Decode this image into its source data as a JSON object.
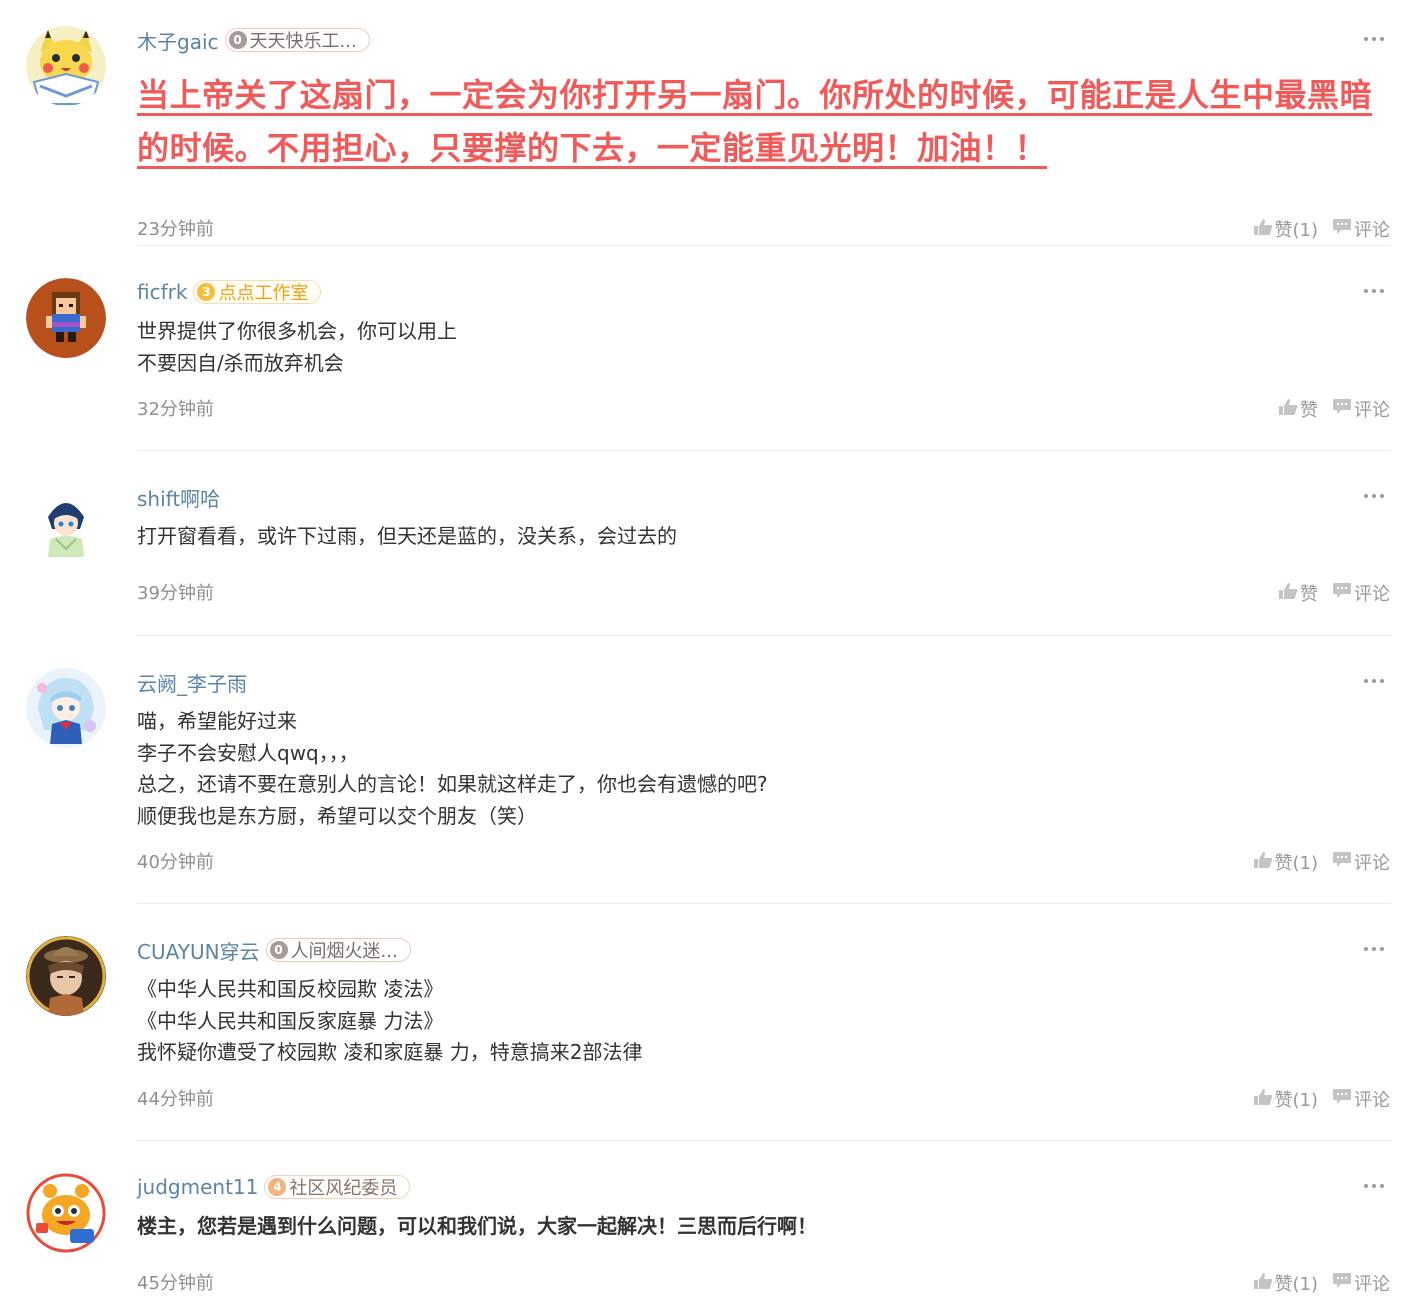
{
  "comments": [
    {
      "username": "木子gaic",
      "badge": {
        "level": "0",
        "text": "天天快乐工...",
        "style": "grey"
      },
      "lines": [
        "当上帝关了这扇门，一定会为你打开另一扇门。你所处的时候，可能正是人生中最黑暗的时候。不用担心，只要撑的下去，一定能重见光明！加油！！"
      ],
      "text_style": "red-bold-underline",
      "time": "23分钟前",
      "like_label": "赞(1)",
      "reply_label": "评论",
      "avatar_icon": "pikachu-avatar-icon"
    },
    {
      "username": "ficfrk",
      "badge": {
        "level": "3",
        "text": "点点工作室",
        "style": "gold"
      },
      "lines": [
        "世界提供了你很多机会，你可以用上",
        "不要因自/杀而放弃机会"
      ],
      "text_style": "normal",
      "time": "32分钟前",
      "like_label": "赞",
      "reply_label": "评论",
      "avatar_icon": "pixel-character-avatar-icon"
    },
    {
      "username": "shift啊哈",
      "badge": null,
      "lines": [
        "打开窗看看，或许下过雨，但天还是蓝的，没关系，会过去的"
      ],
      "text_style": "normal",
      "time": "39分钟前",
      "like_label": "赞",
      "reply_label": "评论",
      "avatar_icon": "anime-boy-avatar-icon"
    },
    {
      "username": "云阙_李子雨",
      "badge": null,
      "lines": [
        "喵，希望能好过来",
        "李子不会安慰人qwq，，，",
        "总之，还请不要在意别人的言论！如果就这样走了，你也会有遗憾的吧?",
        "顺便我也是东方厨，希望可以交个朋友（笑）"
      ],
      "text_style": "normal",
      "time": "40分钟前",
      "like_label": "赞(1)",
      "reply_label": "评论",
      "avatar_icon": "anime-girl-avatar-icon"
    },
    {
      "username": "CUAYUN穿云",
      "badge": {
        "level": "0",
        "text": "人间烟火迷...",
        "style": "grey"
      },
      "lines": [
        "《中华人民共和国反校园欺 凌法》",
        "《中华人民共和国反家庭暴 力法》",
        "我怀疑你遭受了校园欺 凌和家庭暴 力，特意搞来2部法律"
      ],
      "text_style": "normal",
      "time": "44分钟前",
      "like_label": "赞(1)",
      "reply_label": "评论",
      "avatar_icon": "cowboy-avatar-icon"
    },
    {
      "username": "judgment11",
      "badge": {
        "level": "4",
        "text": "社区风纪委员",
        "style": "orange"
      },
      "lines": [
        "楼主，您若是遇到什么问题，可以和我们说，大家一起解决！三思而后行啊！"
      ],
      "text_style": "bold",
      "time": "45分钟前",
      "like_label": "赞(1)",
      "reply_label": "评论",
      "avatar_icon": "mascot-avatar-icon"
    }
  ],
  "colors": {
    "username": "#5a84a8",
    "highlight_text": "#f25a5a",
    "muted": "#999999"
  }
}
